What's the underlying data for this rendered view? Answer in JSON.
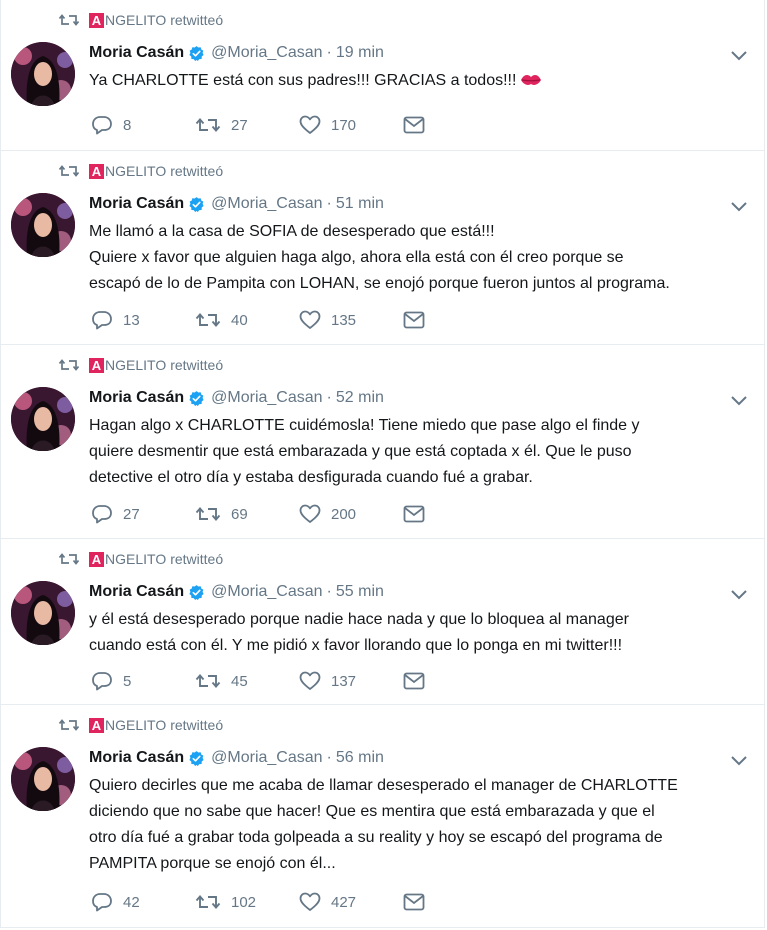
{
  "retweeter": {
    "brand_letter": "A",
    "name_suffix": "NGELITO",
    "verb": "retwitteó"
  },
  "author": {
    "name": "Moria Casán",
    "handle": "@Moria_Casan"
  },
  "colors": {
    "brand_red": "#e0245e",
    "verified_blue": "#1da1f2",
    "secondary_text": "#657786"
  },
  "icons": {
    "retweet_header": "retweet-icon",
    "verified": "verified-badge-icon",
    "caret": "chevron-down-icon",
    "reply": "reply-icon",
    "retweet": "retweet-icon",
    "like": "heart-icon",
    "dm": "envelope-icon",
    "emoji": "kiss-mark-emoji"
  },
  "tweets": [
    {
      "time": "19 min",
      "lines": [
        "Ya CHARLOTTE está con sus padres!!! GRACIAS a todos!!!"
      ],
      "has_kiss": true,
      "replies": "8",
      "retweets": "27",
      "likes": "170"
    },
    {
      "time": "51 min",
      "lines": [
        "Me llamó a la casa de SOFIA de desesperado que está!!!",
        "Quiere x favor que alguien haga algo, ahora ella está con él creo porque se",
        "escapó de lo de Pampita con LOHAN, se enojó porque fueron juntos al programa."
      ],
      "has_kiss": false,
      "replies": "13",
      "retweets": "40",
      "likes": "135"
    },
    {
      "time": "52 min",
      "lines": [
        "Hagan algo x CHARLOTTE cuidémosla! Tiene miedo que pase algo el finde y",
        "quiere desmentir que está embarazada y que está coptada x él. Que le puso",
        "detective el otro día y estaba desfigurada cuando fué a grabar."
      ],
      "has_kiss": false,
      "replies": "27",
      "retweets": "69",
      "likes": "200"
    },
    {
      "time": "55 min",
      "lines": [
        "y él está desesperado porque nadie hace nada y que lo bloquea al manager",
        "cuando está con él. Y me pidió x favor llorando que lo ponga en mi twitter!!!"
      ],
      "has_kiss": false,
      "replies": "5",
      "retweets": "45",
      "likes": "137"
    },
    {
      "time": "56 min",
      "lines": [
        "Quiero decirles que me acaba de llamar desesperado el manager de CHARLOTTE",
        "diciendo que no sabe que hacer! Que es mentira que está embarazada y que el",
        "otro día fué a grabar toda golpeada a su reality y hoy se escapó del programa de",
        "PAMPITA porque se enojó con él..."
      ],
      "has_kiss": false,
      "replies": "42",
      "retweets": "102",
      "likes": "427"
    }
  ]
}
